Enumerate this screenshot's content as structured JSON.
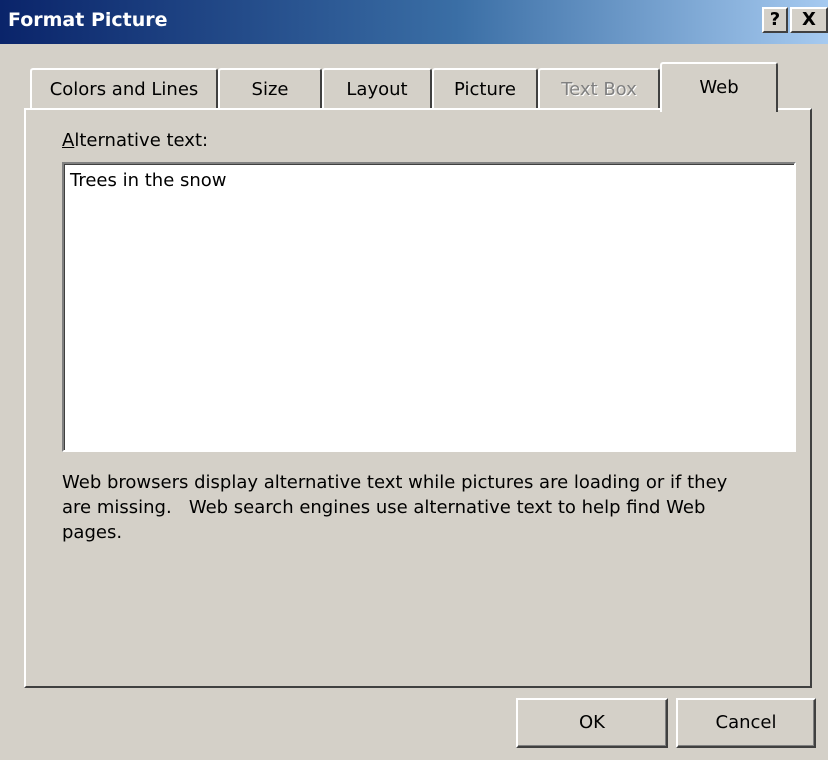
{
  "window": {
    "title": "Format Picture",
    "help_label": "?",
    "close_label": "X"
  },
  "tabs": [
    {
      "label": "Colors and Lines",
      "state": "normal"
    },
    {
      "label": "Size",
      "state": "normal"
    },
    {
      "label": "Layout",
      "state": "normal"
    },
    {
      "label": "Picture",
      "state": "normal"
    },
    {
      "label": "Text Box",
      "state": "disabled"
    },
    {
      "label": "Web",
      "state": "selected"
    }
  ],
  "web": {
    "alt_label_accel": "A",
    "alt_label_rest": "lternative text:",
    "alt_value": "Trees in the snow",
    "help_text": "Web browsers display alternative text while pictures are loading or if they\nare missing.   Web search engines use alternative text to help find Web\npages."
  },
  "buttons": {
    "ok_label": "OK",
    "cancel_label": "Cancel"
  },
  "colors": {
    "title_bar_start": "#0a246a",
    "title_bar_end": "#a6caf0",
    "face": "#d4d0c8",
    "disabled_text": "#808080"
  },
  "icons": {
    "help": "help-icon",
    "close": "close-icon"
  }
}
